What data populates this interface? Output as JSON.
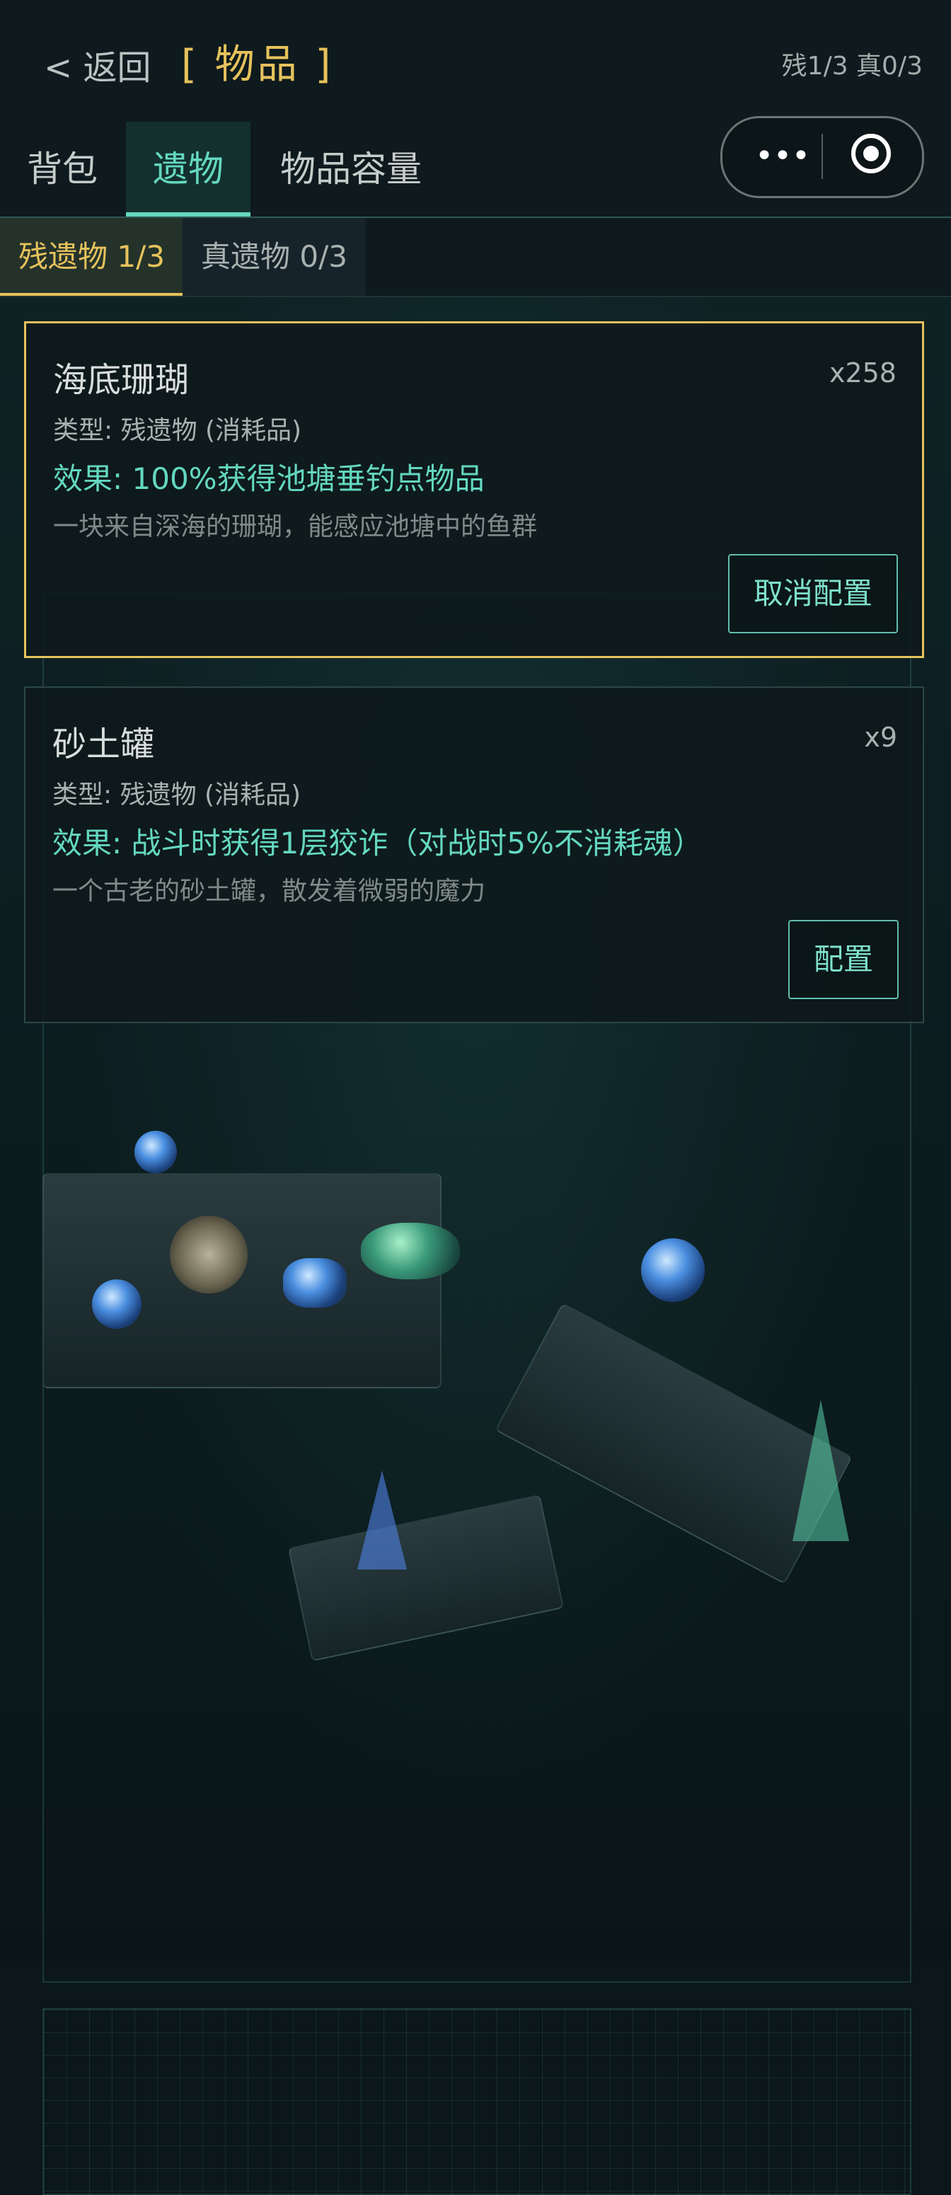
{
  "header": {
    "back_label": "< 返回",
    "title_left_bracket": "[",
    "title": "物品",
    "title_right_bracket": "]",
    "counts": "残1/3  真0/3"
  },
  "tabs": [
    {
      "label": "背包",
      "active": false
    },
    {
      "label": "遗物",
      "active": true
    },
    {
      "label": "物品容量",
      "active": false
    }
  ],
  "capsule": {
    "more_icon": "more-dots-icon",
    "close_icon": "target-icon"
  },
  "subtabs": [
    {
      "label": "残遗物 1/3",
      "active": true
    },
    {
      "label": "真遗物 0/3",
      "active": false
    }
  ],
  "items": [
    {
      "name": "海底珊瑚",
      "qty": "x258",
      "type": "类型: 残遗物 (消耗品)",
      "effect": "效果: 100%获得池塘垂钓点物品",
      "desc": "一块来自深海的珊瑚，能感应池塘中的鱼群",
      "button": "取消配置",
      "selected": true
    },
    {
      "name": "砂土罐",
      "qty": "x9",
      "type": "类型: 残遗物 (消耗品)",
      "effect": "效果: 战斗时获得1层狡诈（对战时5%不消耗魂）",
      "desc": "一个古老的砂土罐，散发着微弱的魔力",
      "button": "配置",
      "selected": false
    }
  ],
  "colors": {
    "accent_teal": "#64d8c0",
    "accent_gold": "#e6c25c",
    "background": "#0b1719"
  }
}
